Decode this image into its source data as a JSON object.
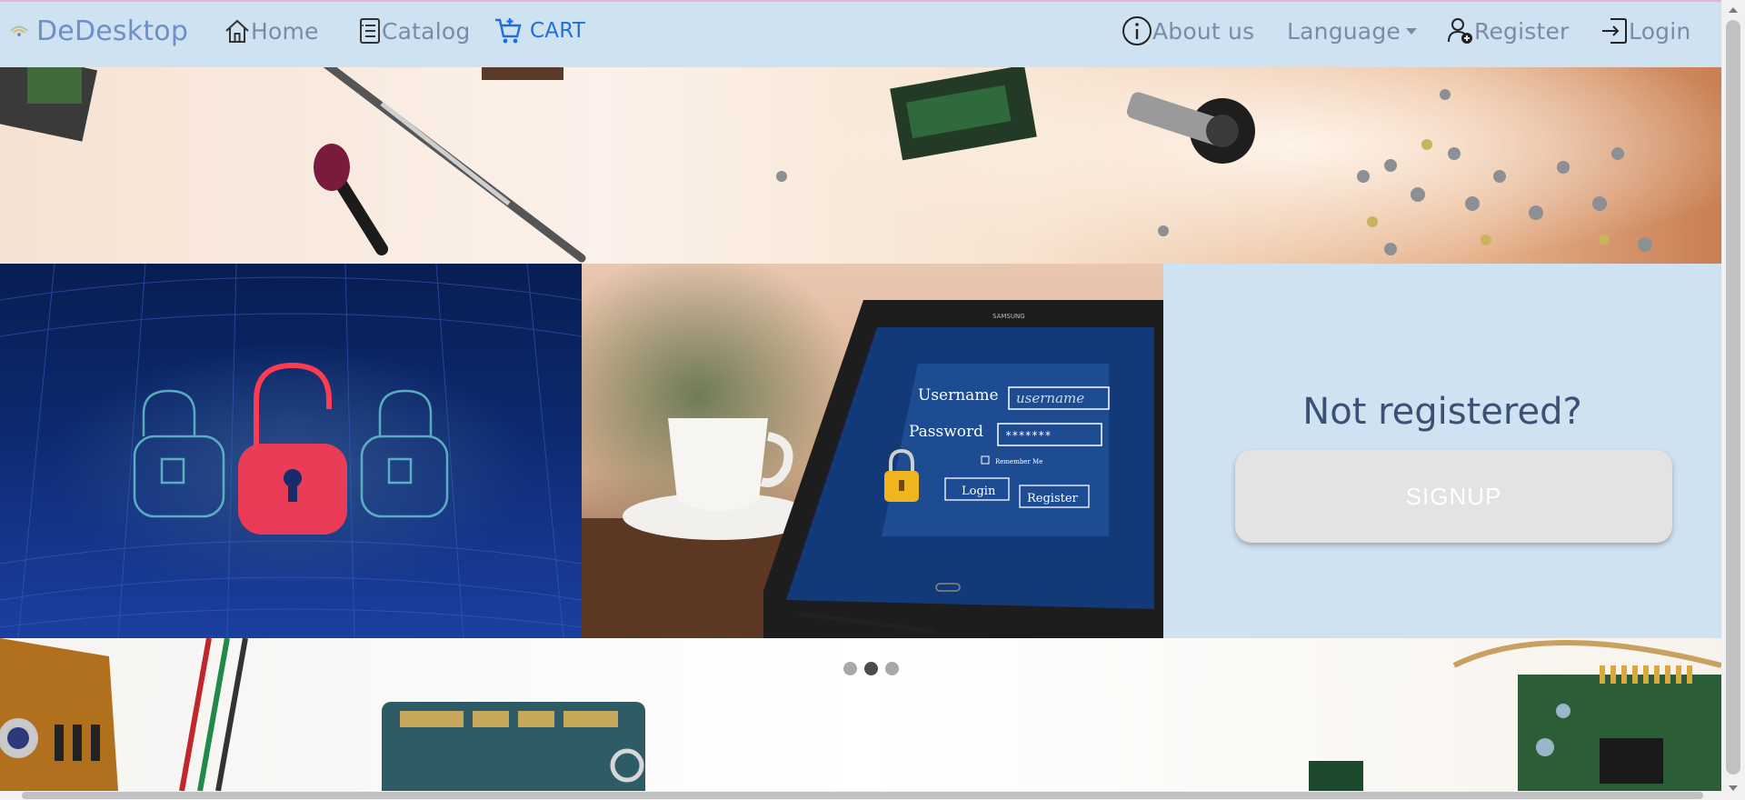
{
  "navbar": {
    "brand": "DeDesktop",
    "home": "Home",
    "catalog": "Catalog",
    "cart": "CART",
    "about": "About us",
    "language": "Language",
    "register": "Register",
    "login": "Login"
  },
  "hero": {
    "tablet_screen": {
      "username_label": "Username",
      "username_placeholder": "username",
      "password_label": "Password",
      "password_mask": "*******",
      "remember": "Remember Me",
      "login": "Login",
      "register": "Register",
      "brand": "SAMSUNG"
    },
    "signup_title": "Not registered?",
    "signup_button": "SIGNUP"
  },
  "carousel": {
    "slides": 3,
    "active": 2
  },
  "colors": {
    "navbar_bg": "#cfe2f2",
    "brand": "#6f8fc8",
    "nav_text": "#7c8aa8",
    "cart_accent": "#1e6fd9",
    "signup_panel": "#cfe2f2",
    "signup_title": "#3c4f74",
    "signup_button": "#e3e3e3"
  },
  "icons": {
    "brand": "logo-icon",
    "home": "home-icon",
    "catalog": "list-icon",
    "cart": "cart-icon",
    "about": "info-icon",
    "register": "person-add-icon",
    "login": "login-icon"
  }
}
